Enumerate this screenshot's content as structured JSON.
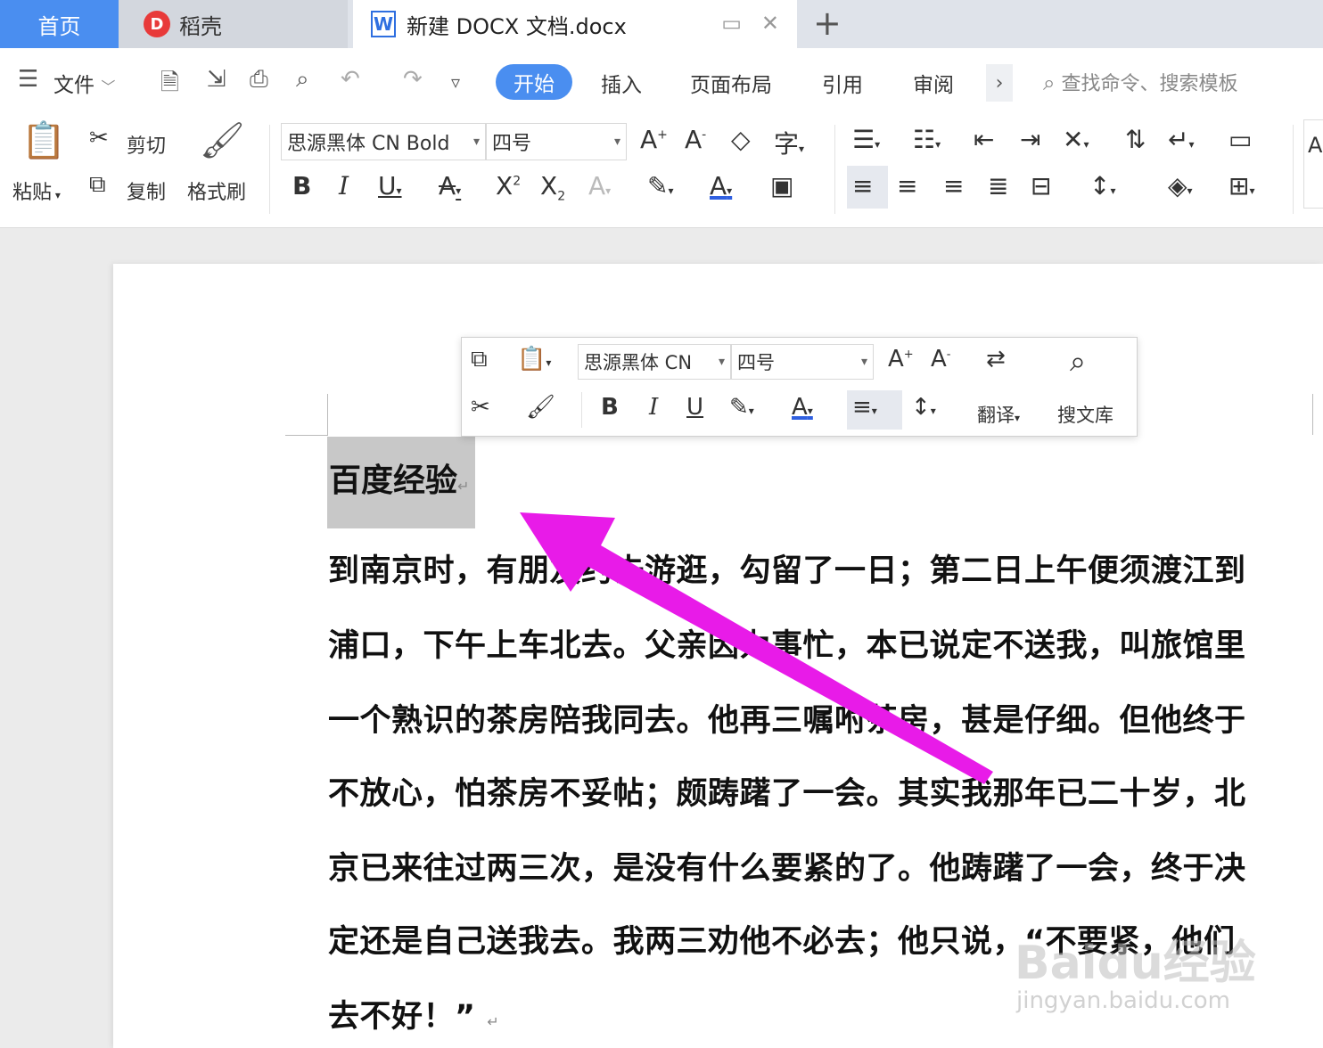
{
  "tabs": {
    "home": "首页",
    "daoke": "稻壳",
    "doc_title": "新建 DOCX 文档.docx",
    "doc_logo": "W",
    "daoke_logo": "D"
  },
  "menu": {
    "file": "文件",
    "items": [
      "开始",
      "插入",
      "页面布局",
      "引用",
      "审阅"
    ],
    "search_placeholder": "查找命令、搜索模板"
  },
  "ribbon": {
    "paste": "粘贴",
    "cut": "剪切",
    "copy": "复制",
    "format_painter": "格式刷",
    "font_name": "思源黑体 CN Bold",
    "font_size": "四号"
  },
  "mini_toolbar": {
    "font_name": "思源黑体 CN",
    "font_size": "四号",
    "translate": "翻译",
    "search_library": "搜文库"
  },
  "document": {
    "heading": "百度经验",
    "lines": [
      "到南京时，有朋友约去游逛，勾留了一日；第二日上午便须渡江到",
      "浦口，下午上车北去。父亲因为事忙，本已说定不送我，叫旅馆里",
      "一个熟识的茶房陪我同去。他再三嘱咐茶房，甚是仔细。但他终于",
      "不放心，怕茶房不妥帖；颇踌躇了一会。其实我那年已二十岁，北",
      "京已来往过两三次，是没有什么要紧的了。他踌躇了一会，终于决",
      "定还是自己送我去。我两三劝他不必去；他只说，“不要紧，他们",
      "去不好！”"
    ]
  },
  "watermark": {
    "brand": "Baidu经验",
    "url": "jingyan.baidu.com"
  },
  "colors": {
    "accent": "#4a8ef0",
    "arrow": "#e81be8"
  }
}
